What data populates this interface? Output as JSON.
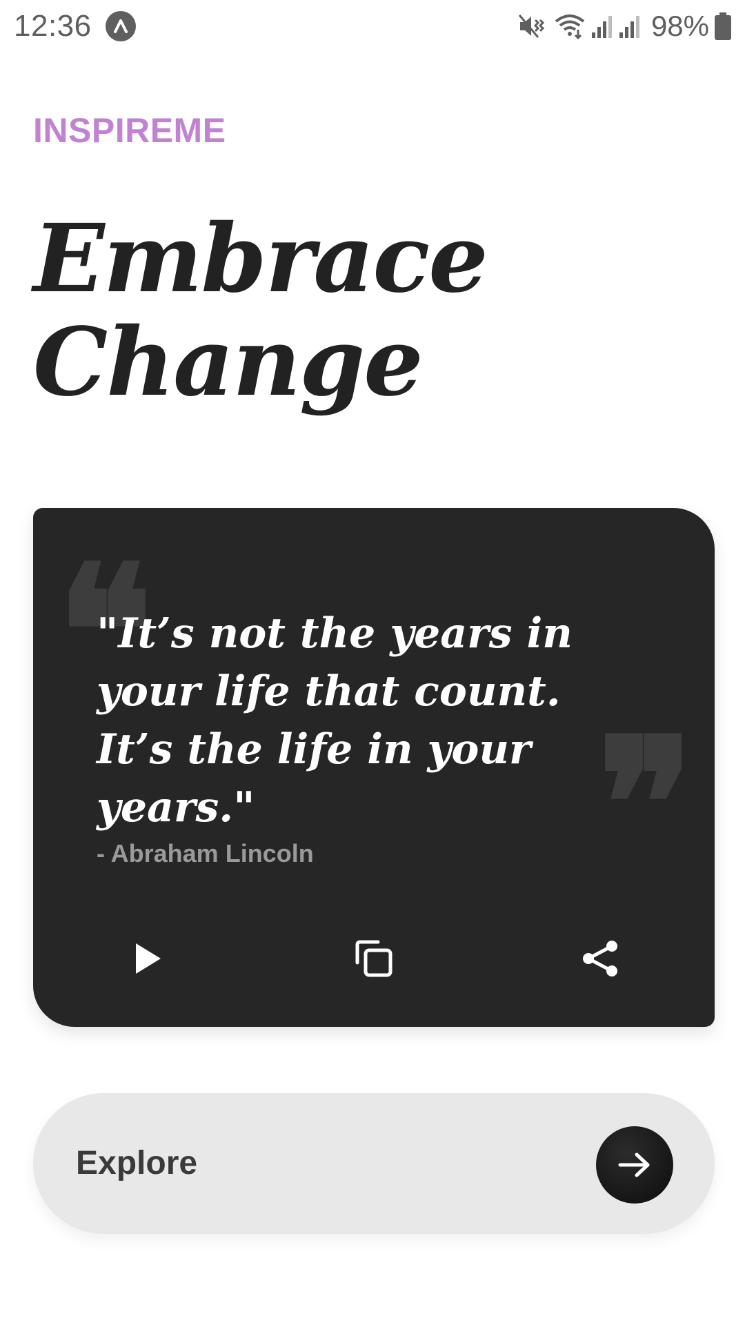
{
  "status_bar": {
    "time": "12:36",
    "battery_percent": "98%",
    "icons": [
      "app-notification-icon",
      "mute-vibrate-icon",
      "wifi-icon",
      "signal-icon",
      "signal-icon",
      "battery-icon"
    ]
  },
  "brand": "INSPIREME",
  "headline": {
    "line1": "Embrace",
    "line2": "Change"
  },
  "quote": {
    "text": "\"It’s not the years in your life that count. It’s the life in your years.\"",
    "author": "- Abraham Lincoln",
    "open_mark": "❝",
    "close_mark": "❞",
    "actions": [
      "play-icon",
      "copy-icon",
      "share-icon"
    ]
  },
  "explore": {
    "label": "Explore",
    "icon": "arrow-right-icon"
  },
  "colors": {
    "brand": "#c183d1",
    "headline": "#222222",
    "card_bg": "#262626",
    "explore_bg": "#e8e8e8"
  }
}
